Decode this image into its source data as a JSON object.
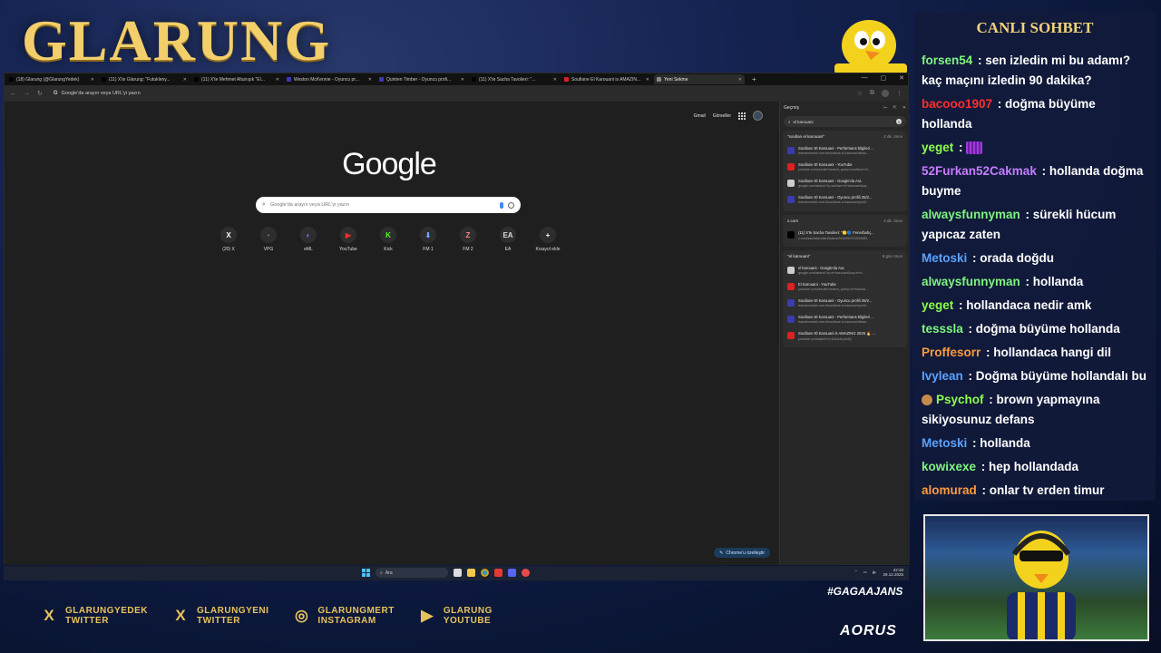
{
  "overlay": {
    "brand": "GLARUNG",
    "hashtag": "#GAGAAJANS",
    "sponsor": "AORUS",
    "socials": [
      {
        "icon": "x-icon",
        "line1": "GLARUNGYEDEK",
        "line2": "TWITTER"
      },
      {
        "icon": "x-icon",
        "line1": "GLARUNGYENI",
        "line2": "TWITTER"
      },
      {
        "icon": "instagram-icon",
        "line1": "GLARUNGMERT",
        "line2": "INSTAGRAM"
      },
      {
        "icon": "youtube-icon",
        "line1": "GLARUNG",
        "line2": "YOUTUBE"
      }
    ]
  },
  "browser": {
    "tabs": [
      {
        "label": "(18) Glarung (@GlarungYedek)",
        "color": "#000000"
      },
      {
        "label": "(11) X'te Glarung: \"Futukleny...",
        "color": "#000000"
      },
      {
        "label": "(11) X'te Mehmet Altunışık \"El...",
        "color": "#000000"
      },
      {
        "label": "Weston McKennie - Oyuncu pr...",
        "color": "#3b3bb0"
      },
      {
        "label": "Quinten Timber - Oyuncu profi...",
        "color": "#3b3bb0"
      },
      {
        "label": "(11) X'te Sacha Tavolieri: \"...",
        "color": "#000000"
      },
      {
        "label": "Soufiane El Karouani is AMAZIN...",
        "color": "#e02020"
      },
      {
        "label": "Yeni Sekme",
        "color": "#888888"
      }
    ],
    "new_tab": "+",
    "omnibox_placeholder": "Google'da arayın veya URL'yi yazın",
    "top_links": {
      "gmail": "Gmail",
      "images": "Görseller"
    },
    "logo": "Google",
    "search_placeholder": "Google'da arayın veya URL'yi yazın",
    "shortcuts": [
      {
        "label": "(20) X",
        "glyph": "X",
        "color": "#ffffff"
      },
      {
        "label": "VPG",
        "glyph": "•",
        "color": "#666666"
      },
      {
        "label": "eML",
        "glyph": "◐",
        "color": "#8a6cff"
      },
      {
        "label": "YouTube",
        "glyph": "▶",
        "color": "#ff2a2a"
      },
      {
        "label": "Kick",
        "glyph": "K",
        "color": "#53fc18"
      },
      {
        "label": "FM 1",
        "glyph": "⬇",
        "color": "#6fa8ff"
      },
      {
        "label": "FM 2",
        "glyph": "Z",
        "color": "#ff8080"
      },
      {
        "label": "EA",
        "glyph": "EA",
        "color": "#dddddd"
      },
      {
        "label": "Kısayol ekle",
        "glyph": "+",
        "color": "#ffffff"
      }
    ],
    "customize": "Chrome'u özelleştir"
  },
  "history": {
    "title": "Geçmiş",
    "query": "el karouani",
    "groups": [
      {
        "heading": "\"soufian el karouani\"",
        "when": "2 dk. önce",
        "items": [
          {
            "title": "Soufiane El Karouani - Performans bilgileri ...",
            "url": "transfermarkt.com.tr/soufiane-el-karouani/leistu...",
            "fav": "#3b3bb0"
          },
          {
            "title": "Soufiane El Karouani - YouTube",
            "url": "youtube.com/results?search_query=soufiane+el...",
            "fav": "#e02020"
          },
          {
            "title": "Soufiane El Karouani - Google'da Ara",
            "url": "google.com/search?q=soufian+el+karouani&oq...",
            "fav": "#cccccc"
          },
          {
            "title": "Soufiane El Karouani - Oyuncu profili 25/2...",
            "url": "transfermarkt.com.tr/soufiane-el-karouani/profil...",
            "fav": "#3b3bb0"
          }
        ]
      },
      {
        "heading": "x.com",
        "when": "4 dk. önce",
        "items": [
          {
            "title": "(11) X'te Sacha Tavolieri: \"🟡🔵 Fenerbahç...",
            "url": "x.com/sachatavolieri/status/2005950701992680...",
            "fav": "#000000"
          }
        ]
      },
      {
        "heading": "\"el karouani\"",
        "when": "9 gün önce",
        "items": [
          {
            "title": "el karouani - Google'da Ara",
            "url": "google.com/search?q=el+karouani&oq=el+k...",
            "fav": "#cccccc"
          },
          {
            "title": "El Karouani - YouTube",
            "url": "youtube.com/results?search_query=el+karoua...",
            "fav": "#e02020"
          },
          {
            "title": "Soufiane El Karouani - Oyuncu profili 25/2...",
            "url": "transfermarkt.com.tr/soufiane-el-karouani/profil...",
            "fav": "#3b3bb0"
          },
          {
            "title": "Soufiane El Karouani - Performans bilgileri ...",
            "url": "transfermarkt.com.tr/soufiane-el-karouani/leistu...",
            "fav": "#3b3bb0"
          },
          {
            "title": "Soufiane El Karouani is AMAZING 2025 🔥 ...",
            "url": "youtube.com/watch?v=Dduv4LpfwfQ",
            "fav": "#e02020"
          }
        ]
      }
    ]
  },
  "taskbar": {
    "search": "Ara",
    "time": "22:33",
    "date": "29.12.2025"
  },
  "chat": {
    "title": "CANLI SOHBET",
    "messages": [
      {
        "user": "forsen54",
        "color": "#7ef57e",
        "text": "sen izledin mi bu adamı? kaç maçını izledin 90 dakika?"
      },
      {
        "user": "bacooo1907",
        "color": "#ff2d2d",
        "text": "doğma büyüme hollanda"
      },
      {
        "user": "yeget",
        "color": "#8bff4a",
        "text": "",
        "emote": true
      },
      {
        "user": "52Furkan52Cakmak",
        "color": "#c77dff",
        "text": "hollanda doğma buyme"
      },
      {
        "user": "alwaysfunnyman",
        "color": "#7ef57e",
        "text": "sürekli hücum yapıcaz zaten"
      },
      {
        "user": "Metoski",
        "color": "#5aa2ff",
        "text": "orada doğdu"
      },
      {
        "user": "alwaysfunnyman",
        "color": "#7ef57e",
        "text": "hollanda"
      },
      {
        "user": "yeget",
        "color": "#8bff4a",
        "text": "hollandaca nedir amk"
      },
      {
        "user": "tesssla",
        "color": "#7ef57e",
        "text": "doğma büyüme hollanda"
      },
      {
        "user": "Proffesorr",
        "color": "#ff9a3c",
        "text": "hollandaca hangi dil"
      },
      {
        "user": "Ivylean",
        "color": "#5aa2ff",
        "text": "Doğma büyüme hollandalı bu"
      },
      {
        "user": "Psychof",
        "color": "#8bff4a",
        "text": "brown yapmayına sikiyosunuz defans",
        "pfp": true
      },
      {
        "user": "Metoski",
        "color": "#5aa2ff",
        "text": "hollanda"
      },
      {
        "user": "kowixexe",
        "color": "#7ef57e",
        "text": "hep hollandada"
      },
      {
        "user": "alomurad",
        "color": "#ff9a3c",
        "text": "onlar tv erden timur konusuluyor"
      }
    ]
  }
}
